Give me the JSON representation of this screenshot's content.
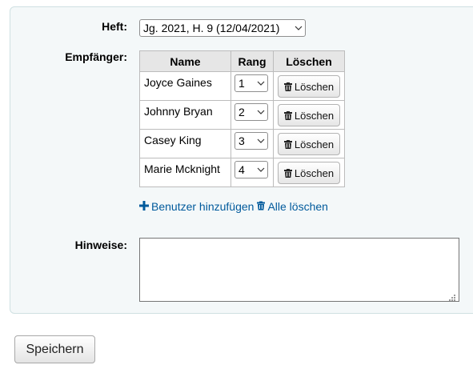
{
  "form": {
    "issue_label": "Heft:",
    "issue_value": "Jg. 2021, H. 9 (12/04/2021)",
    "recipients_label": "Empfänger:",
    "notes_label": "Hinweise:",
    "notes_value": ""
  },
  "table": {
    "headers": {
      "name": "Name",
      "rank": "Rang",
      "delete": "Löschen"
    },
    "rows": [
      {
        "name": "Joyce Gaines",
        "rank": "1",
        "delete_label": "Löschen"
      },
      {
        "name": "Johnny Bryan",
        "rank": "2",
        "delete_label": "Löschen"
      },
      {
        "name": "Casey King",
        "rank": "3",
        "delete_label": "Löschen"
      },
      {
        "name": "Marie Mcknight",
        "rank": "4",
        "delete_label": "Löschen"
      }
    ]
  },
  "actions": {
    "add_user_label": "Benutzer hinzufügen",
    "add_user_icon": "plus-icon",
    "delete_all_label": "Alle löschen",
    "delete_all_icon": "trash-icon",
    "save_label": "Speichern"
  },
  "colors": {
    "link": "#005a9c",
    "panel_background": "#f4f8f9"
  }
}
